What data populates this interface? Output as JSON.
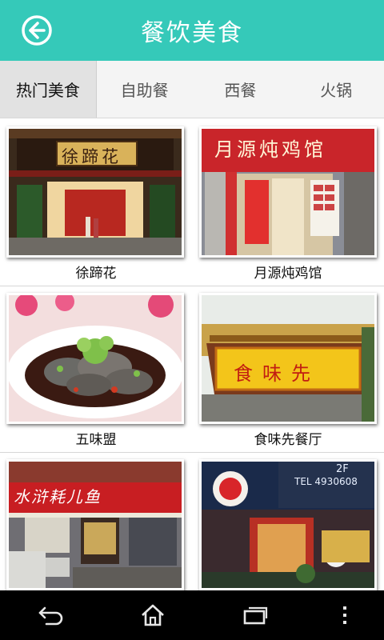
{
  "header": {
    "title": "餐饮美食"
  },
  "tabs": [
    {
      "label": "热门美食",
      "active": true
    },
    {
      "label": "自助餐",
      "active": false
    },
    {
      "label": "西餐",
      "active": false
    },
    {
      "label": "火锅",
      "active": false
    }
  ],
  "restaurants": [
    {
      "name": "徐蹄花",
      "sign": "徐蹄花"
    },
    {
      "name": "月源炖鸡馆",
      "sign": "月源炖鸡馆"
    },
    {
      "name": "五味盟",
      "sign": ""
    },
    {
      "name": "食味先餐厅",
      "sign": "食味先"
    },
    {
      "name": "",
      "sign": "水浒耗儿鱼"
    },
    {
      "name": "",
      "sign": "TEL 4930608",
      "floor": "2F"
    }
  ],
  "nav": {
    "back_icon": "back-arrow-icon",
    "home_icon": "home-icon",
    "recent_icon": "recent-apps-icon",
    "menu_icon": "overflow-menu-icon"
  },
  "colors": {
    "accent": "#35c9b9",
    "tab_bg": "#f4f4f4",
    "tab_active_bg": "#e2e2e2"
  }
}
